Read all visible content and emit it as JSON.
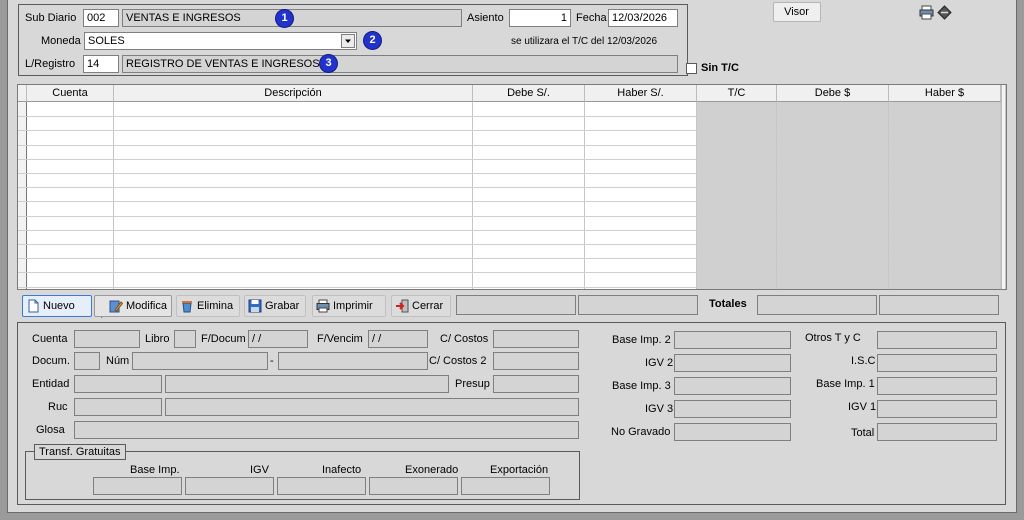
{
  "header": {
    "sub_diario_label": "Sub Diario",
    "sub_diario_code": "002",
    "sub_diario_name": "VENTAS E INGRESOS",
    "asiento_label": "Asiento",
    "asiento_value": "1",
    "fecha_label": "Fecha",
    "fecha_value": "12/03/2026",
    "moneda_label": "Moneda",
    "moneda_value": "SOLES",
    "tc_note": "se utilizara el T/C del 12/03/2026",
    "registro_label": "L/Registro",
    "registro_code": "14",
    "registro_name": "REGISTRO DE VENTAS E INGRESOS",
    "sin_tc_label": "Sin T/C",
    "visor_label": "Visor",
    "badges": [
      "1",
      "2",
      "3"
    ]
  },
  "grid": {
    "columns": [
      "Cuenta",
      "Descripción",
      "Debe S/.",
      "Haber S/.",
      "T/C",
      "Debe $",
      "Haber $"
    ]
  },
  "toolbar": {
    "nuevo": "Nuevo",
    "modifica": "Modifica",
    "elimina": "Elimina",
    "grabar": "Grabar",
    "imprimir": "Imprimir",
    "cerrar": "Cerrar",
    "totales": "Totales"
  },
  "detail": {
    "cuenta": "Cuenta",
    "libro": "Libro",
    "f_docum": "F/Docum",
    "f_docum_value": " / /",
    "f_vencim": "F/Vencim",
    "f_vencim_value": " / /",
    "c_costos": "C/ Costos",
    "docum": "Docum.",
    "num": "Núm",
    "dash": "-",
    "c_costos2": "C/ Costos 2",
    "entidad": "Entidad",
    "presup": "Presup",
    "ruc": "Ruc",
    "glosa": "Glosa",
    "base_imp2": "Base Imp. 2",
    "igv2": "IGV 2",
    "base_imp3": "Base Imp. 3",
    "igv3": "IGV 3",
    "no_gravado": "No Gravado",
    "otros_tyc": "Otros T y C",
    "isc": "I.S.C",
    "base_imp1": "Base Imp. 1",
    "igv1": "IGV 1",
    "total": "Total"
  },
  "gratuitas": {
    "title": "Transf. Gratuitas",
    "cols": [
      "Base Imp.",
      "IGV",
      "Inafecto",
      "Exonerado",
      "Exportación"
    ]
  },
  "colors": {
    "badge": "#2233cc",
    "window": "#d8d8d8",
    "field": "#d4d4d4"
  }
}
